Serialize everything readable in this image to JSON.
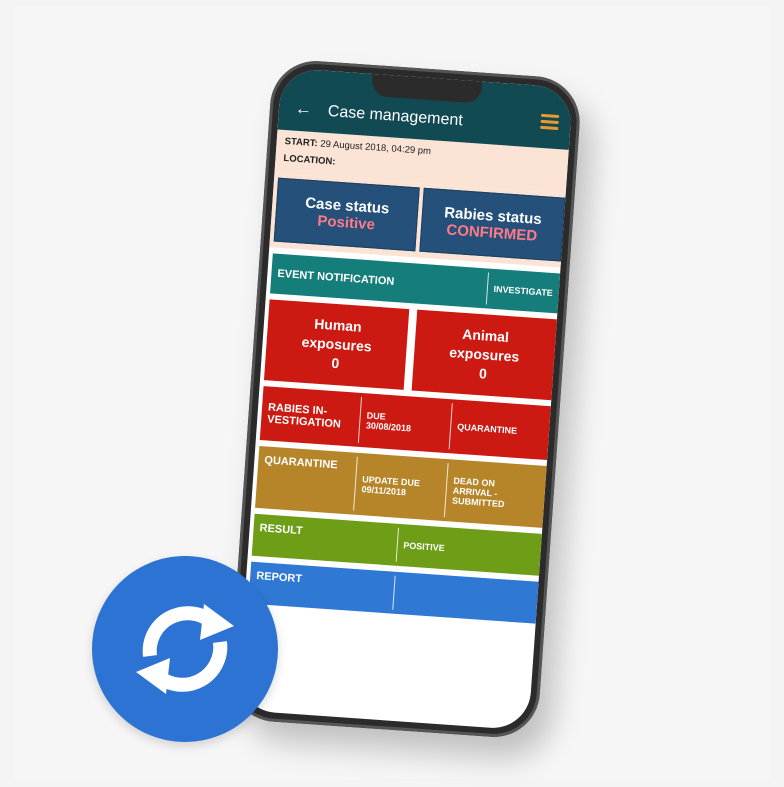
{
  "appbar": {
    "back_icon": "arrow-left-icon",
    "title": "Case management",
    "menu_icon": "hamburger-menu-icon"
  },
  "info": {
    "start_label": "START:",
    "start_value": "29 August 2018, 04:29 pm",
    "location_label": "LOCATION:"
  },
  "case_status": {
    "label": "Case status",
    "value": "Positive"
  },
  "rabies_status": {
    "label": "Rabies status",
    "value": "CONFIRMED"
  },
  "event": {
    "label": "EVENT NOTIFICATION",
    "action": "INVESTIGATE"
  },
  "human_exposures": {
    "line1": "Human",
    "line2": "exposures",
    "count": "0"
  },
  "animal_exposures": {
    "line1": "Animal",
    "line2": "exposures",
    "count": "0"
  },
  "investigation": {
    "label_line1": "RABIES IN-",
    "label_line2": "VESTIGATION",
    "due_label": "DUE",
    "due_date": "30/08/2018",
    "action": "QUARANTINE"
  },
  "quarantine": {
    "label": "QUARANTINE",
    "update_label": "UPDATE DUE",
    "update_date": "09/11/2018",
    "status_line1": "DEAD ON",
    "status_line2": "ARRIVAL -",
    "status_line3": "SUBMITTED"
  },
  "result": {
    "label": "RESULT",
    "value": "POSITIVE"
  },
  "report": {
    "label": "REPORT"
  },
  "colors": {
    "appbar": "#124a54",
    "status_box": "#24507a",
    "teal": "#157d7a",
    "red": "#cc1a12",
    "ochre": "#b6852a",
    "green": "#6e9d18",
    "blue": "#2f79d5",
    "sync_badge": "#2d73d4"
  },
  "sync_badge_icon": "sync-refresh-icon"
}
